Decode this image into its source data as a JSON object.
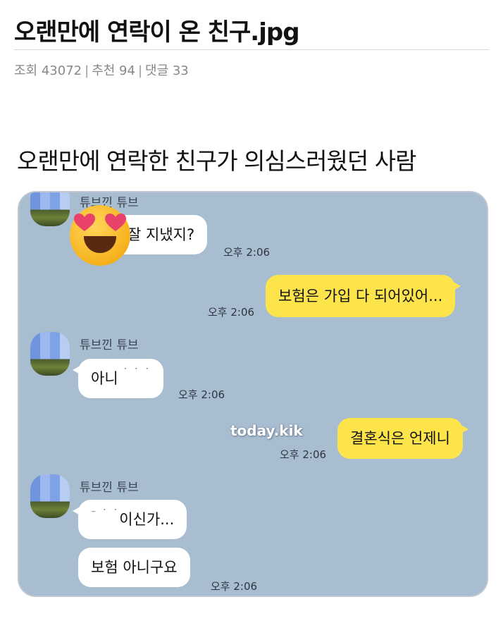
{
  "post": {
    "title": "오랜만에 연락이 온 친구.jpg",
    "meta": {
      "views": "조회 43072",
      "recommend": "추천 94",
      "comments": "댓글 33",
      "separator": "|"
    }
  },
  "image": {
    "caption": "오랜만에 연락한 친구가 의심스러웠던 사람",
    "watermark": "today.kik",
    "chat": {
      "messages": [
        {
          "sender": "튜브낀 튜브",
          "text": "잘 지냈지?",
          "time": "오후 2:06"
        },
        {
          "sender": "me",
          "text": "보험은 가입 다 되어있어...",
          "time": "오후 2:06"
        },
        {
          "sender": "튜브낀 튜브",
          "text": "아니",
          "text_partial": "˙ ˙ ˙",
          "time": "오후 2:06"
        },
        {
          "sender": "me",
          "text": "결혼식은 언제니",
          "time": "오후 2:06"
        },
        {
          "sender": "튜브낀 튜브",
          "text_partial": "⁻ ˙ ˙",
          "text": "이신가...",
          "time": ""
        },
        {
          "sender": "튜브낀 튜브",
          "text": "보험 아니구요",
          "time": "오후 2:06"
        }
      ]
    }
  }
}
